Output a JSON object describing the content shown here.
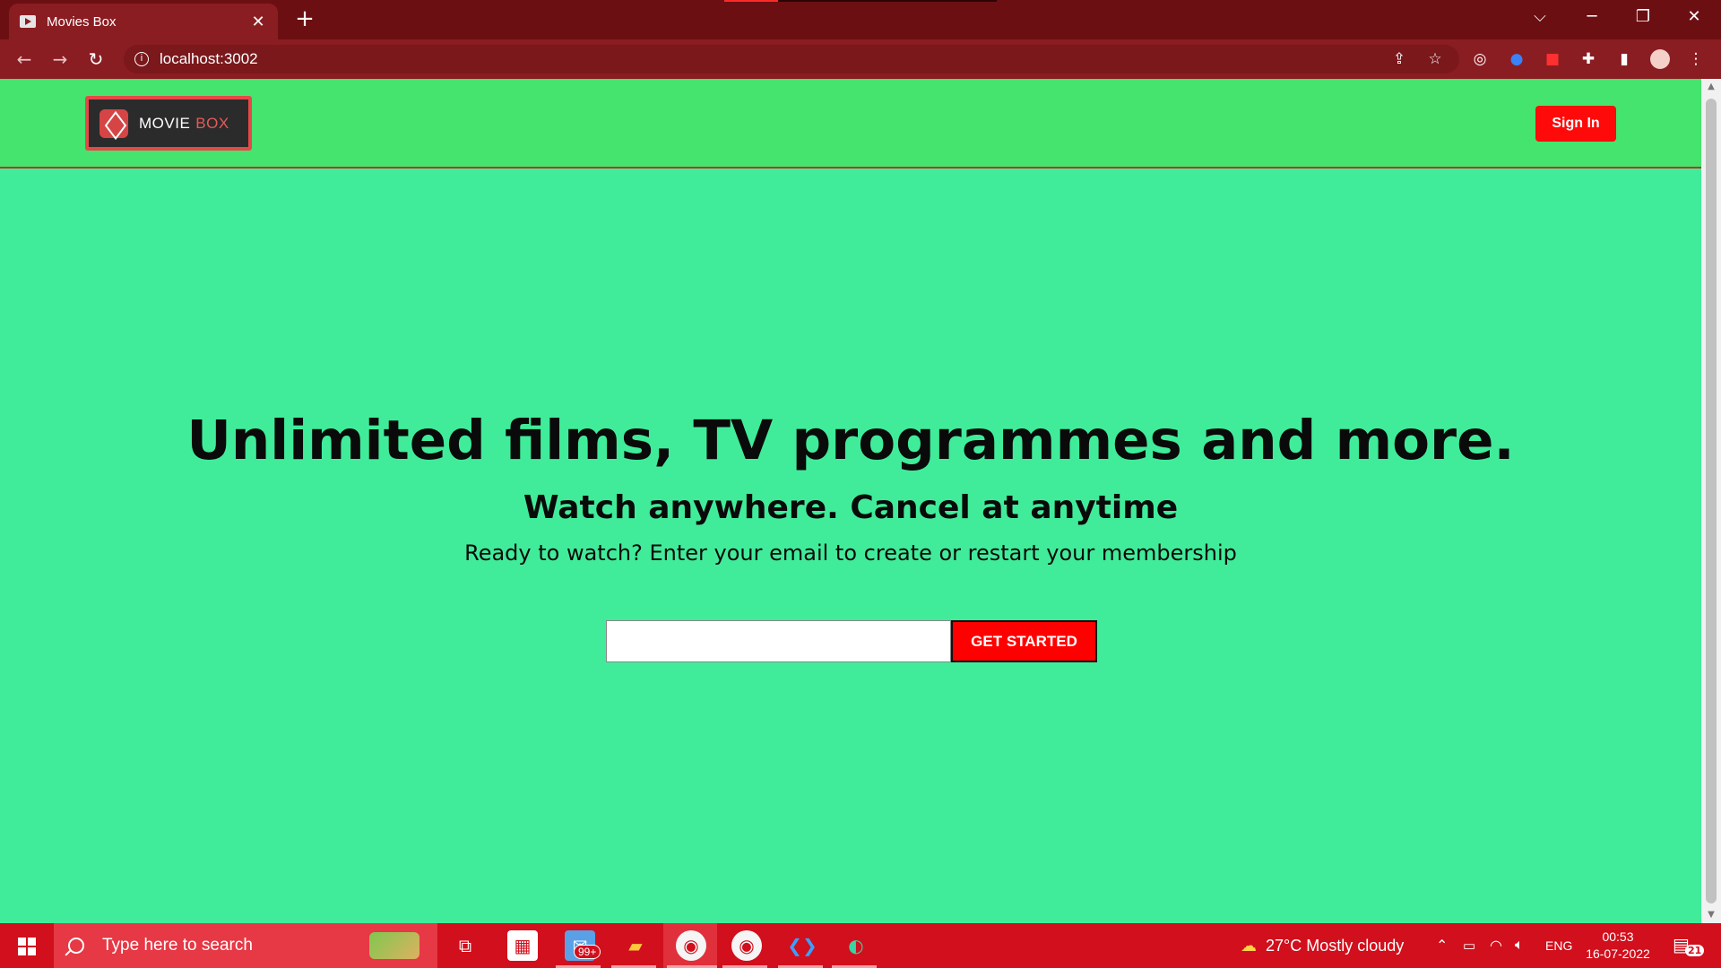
{
  "browser": {
    "tab_title": "Movies Box",
    "tab_close": "✕",
    "new_tab": "+",
    "url": "localhost:3002",
    "controls": {
      "tabs_menu": "⌵",
      "minimize": "─",
      "restore": "❐",
      "close": "✕"
    }
  },
  "header": {
    "logo_word1": "MOVIE",
    "logo_word2": "BOX",
    "signin_label": "Sign In"
  },
  "hero": {
    "headline": "Unlimited films, TV programmes and more.",
    "subheadline": "Watch anywhere. Cancel at anytime",
    "prompt": "Ready to watch? Enter your email to create or restart your membership",
    "email_value": "",
    "cta_label": "GET STARTED"
  },
  "taskbar": {
    "search_placeholder": "Type here to search",
    "mail_badge": "99+",
    "weather": "27°C  Mostly cloudy",
    "language": "ENG",
    "time": "00:53",
    "date": "16-07-2022",
    "notifications": "21"
  },
  "colors": {
    "page_bg": "#40ec9a",
    "header_bg": "#44e46e",
    "accent_red": "#ff0000",
    "browser_frame": "#8a1d22"
  }
}
